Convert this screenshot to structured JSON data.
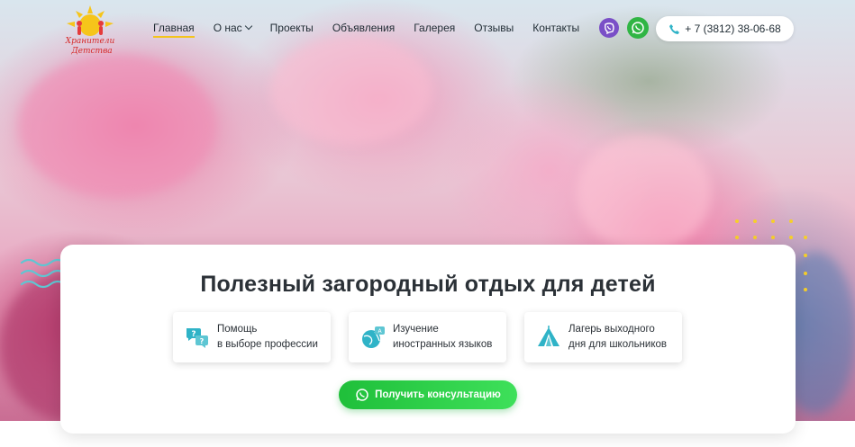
{
  "brand": {
    "logo_line1": "Хранители",
    "logo_line2": "Детства"
  },
  "nav": {
    "items": [
      {
        "label": "Главная",
        "active": true,
        "has_dropdown": false
      },
      {
        "label": "О нас",
        "active": false,
        "has_dropdown": true
      },
      {
        "label": "Проекты",
        "active": false,
        "has_dropdown": false
      },
      {
        "label": "Объявления",
        "active": false,
        "has_dropdown": false
      },
      {
        "label": "Галерея",
        "active": false,
        "has_dropdown": false
      },
      {
        "label": "Отзывы",
        "active": false,
        "has_dropdown": false
      },
      {
        "label": "Контакты",
        "active": false,
        "has_dropdown": false
      }
    ]
  },
  "contacts": {
    "viber_icon": "viber-icon",
    "whatsapp_icon": "whatsapp-icon",
    "phone": "+ 7 (3812) 38-06-68"
  },
  "card": {
    "title": "Полезный загородный отдых для детей",
    "features": [
      {
        "icon": "chat-bubbles-icon",
        "line1": "Помощь",
        "line2": "в выборе профессии"
      },
      {
        "icon": "globe-icon",
        "line1": "Изучение",
        "line2": "иностранных языков"
      },
      {
        "icon": "tent-icon",
        "line1": "Лагерь выходного",
        "line2": "дня для школьников"
      }
    ],
    "cta_label": "Получить консультацию"
  },
  "colors": {
    "accent_yellow": "#f3c41c",
    "cta_green": "#2ccf47",
    "icon_teal": "#2fb3c7",
    "viber": "#7a4fc7",
    "whatsapp": "#30b544",
    "text_dark": "#2b3137"
  }
}
